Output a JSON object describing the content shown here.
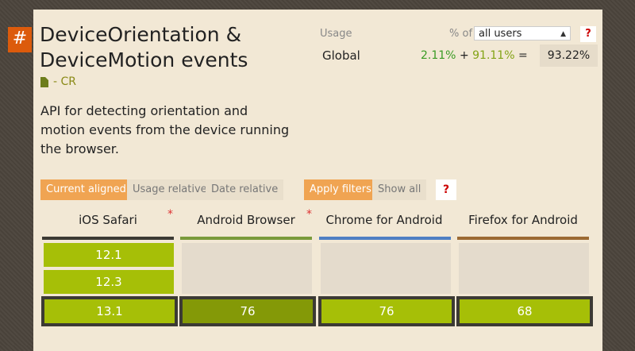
{
  "feature": {
    "hash": "#",
    "title_line1": "DeviceOrientation &",
    "title_line2": "DeviceMotion events",
    "status": "- CR",
    "description": "API for detecting orientation and motion events from the device running the browser."
  },
  "usage": {
    "label": "Usage",
    "pct_of": "% of",
    "select_value": "all users",
    "help": "?",
    "region": "Global",
    "supported": "2.11%",
    "plus": "+",
    "partial": "91.11%",
    "equals": "=",
    "total": "93.22%"
  },
  "filters": {
    "current_aligned": "Current aligned",
    "usage_relative": "Usage relative",
    "date_relative": "Date relative",
    "apply_filters": "Apply filters",
    "show_all": "Show all",
    "help": "?"
  },
  "browsers": [
    {
      "name": "iOS Safari",
      "note": "*",
      "color": "#3c3a34",
      "past": [
        "12.1",
        "12.3"
      ],
      "current": "13.1"
    },
    {
      "name": "Android Browser",
      "note": "*",
      "color": "#7a9a3b",
      "past": [],
      "current": "76"
    },
    {
      "name": "Chrome for Android",
      "note": "",
      "color": "#4f7fc3",
      "past": [],
      "current": "76"
    },
    {
      "name": "Firefox for Android",
      "note": "",
      "color": "#9c6a33",
      "past": [],
      "current": "68"
    }
  ]
}
